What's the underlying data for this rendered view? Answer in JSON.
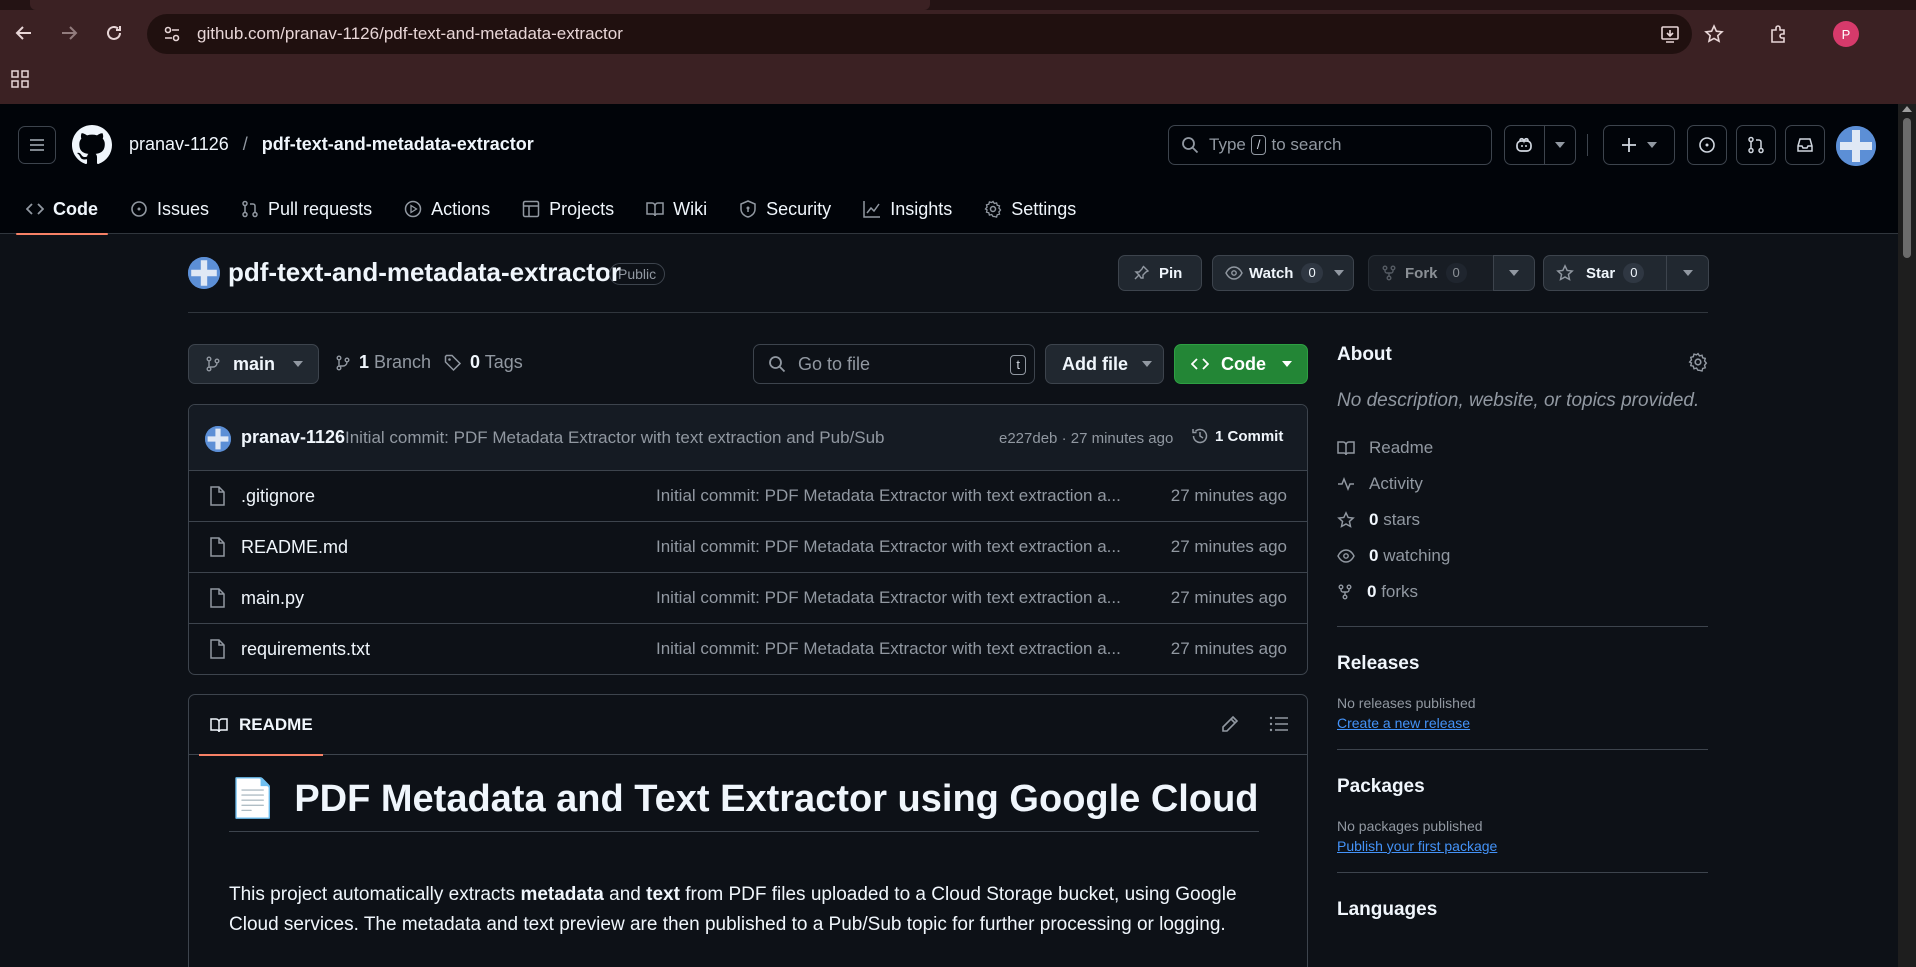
{
  "browser": {
    "url_host": "github.com",
    "url_path": "/pranav-1126/pdf-text-and-metadata-extractor",
    "profile_initial": "P"
  },
  "header": {
    "owner": "pranav-1126",
    "separator": "/",
    "repo": "pdf-text-and-metadata-extractor",
    "search_prefix": "Type",
    "search_key": "/",
    "search_suffix": "to search"
  },
  "tabs": [
    {
      "label": "Code",
      "icon": "code-icon",
      "active": true
    },
    {
      "label": "Issues",
      "icon": "issue-icon"
    },
    {
      "label": "Pull requests",
      "icon": "pull-request-icon"
    },
    {
      "label": "Actions",
      "icon": "play-icon"
    },
    {
      "label": "Projects",
      "icon": "table-icon"
    },
    {
      "label": "Wiki",
      "icon": "book-icon"
    },
    {
      "label": "Security",
      "icon": "shield-icon"
    },
    {
      "label": "Insights",
      "icon": "graph-icon"
    },
    {
      "label": "Settings",
      "icon": "gear-icon"
    }
  ],
  "repo_title": {
    "name": "pdf-text-and-metadata-extractor",
    "visibility": "Public",
    "pin_label": "Pin",
    "watch_label": "Watch",
    "watch_count": "0",
    "fork_label": "Fork",
    "fork_count": "0",
    "star_label": "Star",
    "star_count": "0"
  },
  "file_nav": {
    "branch": "main",
    "branch_count": "1",
    "branch_label": "Branch",
    "tag_count": "0",
    "tag_label": "Tags",
    "goto_placeholder": "Go to file",
    "goto_key": "t",
    "add_file_label": "Add file",
    "code_label": "Code"
  },
  "latest_commit": {
    "author": "pranav-1126",
    "message": "Initial commit: PDF Metadata Extractor with text extraction and Pub/Sub",
    "meta": "e227deb · 27 minutes ago",
    "commit_count": "1 Commit"
  },
  "files": [
    {
      "name": ".gitignore",
      "message": "Initial commit: PDF Metadata Extractor with text extraction a...",
      "time": "27 minutes ago"
    },
    {
      "name": "README.md",
      "message": "Initial commit: PDF Metadata Extractor with text extraction a...",
      "time": "27 minutes ago"
    },
    {
      "name": "main.py",
      "message": "Initial commit: PDF Metadata Extractor with text extraction a...",
      "time": "27 minutes ago"
    },
    {
      "name": "requirements.txt",
      "message": "Initial commit: PDF Metadata Extractor with text extraction a...",
      "time": "27 minutes ago"
    }
  ],
  "readme": {
    "tab_label": "README",
    "heading_emoji": "📄",
    "heading": "PDF Metadata and Text Extractor using Google Cloud",
    "para_1": "This project automatically extracts ",
    "para_bold_1": "metadata",
    "para_2": " and ",
    "para_bold_2": "text",
    "para_3": " from PDF files uploaded to a Cloud Storage bucket, using Google Cloud services. The metadata and text preview are then published to a Pub/Sub topic for further processing or logging."
  },
  "sidebar": {
    "about_title": "About",
    "description": "No description, website, or topics provided.",
    "readme_label": "Readme",
    "activity_label": "Activity",
    "stars_count": "0",
    "stars_label": "stars",
    "watching_count": "0",
    "watching_label": "watching",
    "forks_count": "0",
    "forks_label": "forks",
    "releases_title": "Releases",
    "releases_empty": "No releases published",
    "releases_link": "Create a new release",
    "packages_title": "Packages",
    "packages_empty": "No packages published",
    "packages_link": "Publish your first package",
    "languages_title": "Languages"
  }
}
